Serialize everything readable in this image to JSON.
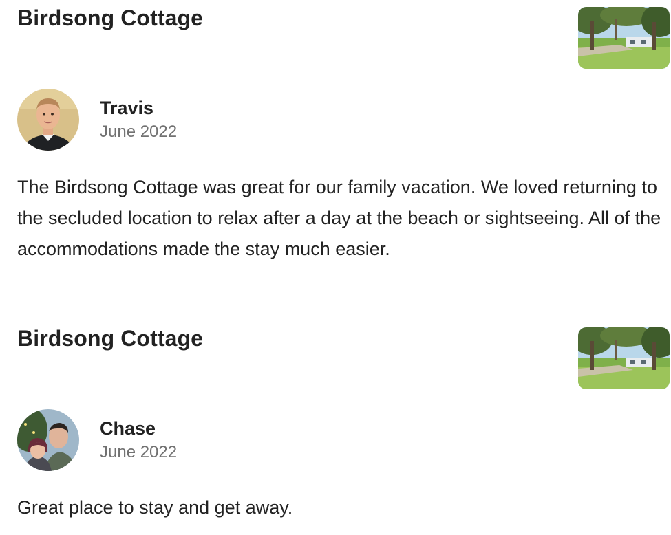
{
  "reviews": [
    {
      "listing_title": "Birdsong Cottage",
      "reviewer_name": "Travis",
      "date": "June 2022",
      "text": "The Birdsong Cottage was great for our family vacation. We loved returning to the secluded location to relax after a day at the beach or sightseeing. All of the accommodations made the stay much easier."
    },
    {
      "listing_title": "Birdsong Cottage",
      "reviewer_name": "Chase",
      "date": "June 2022",
      "text": "Great place to stay and get away."
    }
  ],
  "colors": {
    "text_primary": "#222222",
    "text_secondary": "#717171",
    "divider": "#dddddd"
  }
}
